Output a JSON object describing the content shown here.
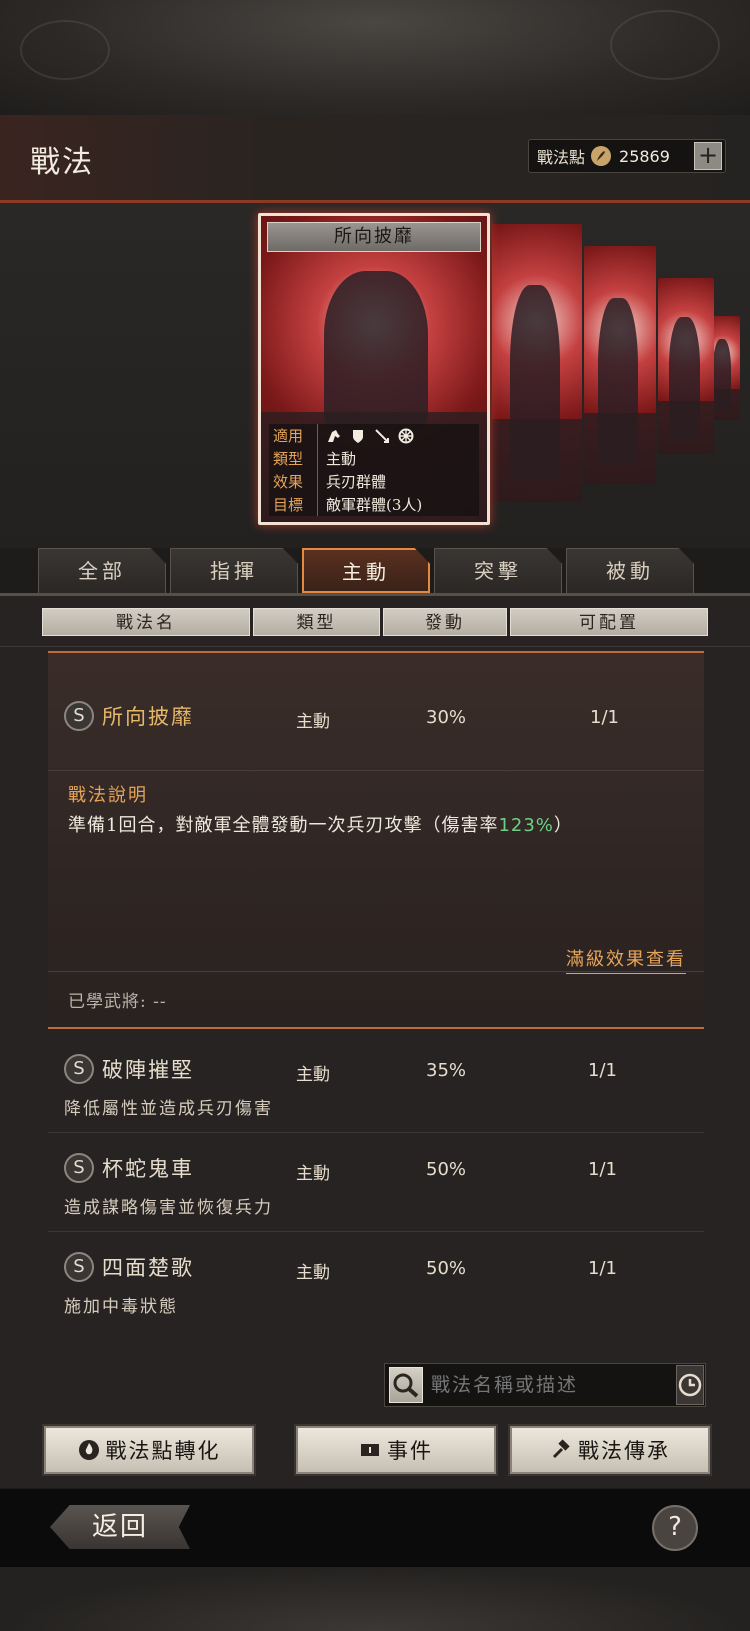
{
  "header": {
    "title": "戰法",
    "points_label": "戰法點",
    "points_value": "25869",
    "plus_label": "+"
  },
  "featured_card": {
    "title": "所向披靡",
    "applicable_label": "適用",
    "applicable_icons": [
      "cavalry-icon",
      "shield-icon",
      "bow-icon",
      "siege-wheel-icon"
    ],
    "type_label": "類型",
    "type_value": "主動",
    "effect_label": "效果",
    "effect_value": "兵刃群體",
    "target_label": "目標",
    "target_value": "敵軍群體(3人)"
  },
  "tabs": [
    {
      "label": "全部",
      "active": false
    },
    {
      "label": "指揮",
      "active": false
    },
    {
      "label": "主動",
      "active": true
    },
    {
      "label": "突擊",
      "active": false
    },
    {
      "label": "被動",
      "active": false
    }
  ],
  "columns": [
    "戰法名",
    "類型",
    "發動",
    "可配置"
  ],
  "expanded_skill": {
    "badge": "S",
    "name": "所向披靡",
    "type": "主動",
    "rate": "30%",
    "slots": "1/1",
    "desc_title": "戰法說明",
    "desc_text": "準備1回合，對敵軍全體發動一次兵刃攻擊（傷害率",
    "desc_highlight": "123%",
    "desc_end": "）",
    "full_effect_link": "滿級效果查看",
    "learned_label": "已學武將: --"
  },
  "skills": [
    {
      "badge": "S",
      "name": "破陣摧堅",
      "type": "主動",
      "rate": "35%",
      "slots": "1/1",
      "desc": "降低屬性並造成兵刃傷害"
    },
    {
      "badge": "S",
      "name": "杯蛇鬼車",
      "type": "主動",
      "rate": "50%",
      "slots": "1/1",
      "desc": "造成謀略傷害並恢復兵力"
    },
    {
      "badge": "S",
      "name": "四面楚歌",
      "type": "主動",
      "rate": "50%",
      "slots": "1/1",
      "desc": "施加中毒狀態"
    }
  ],
  "search": {
    "placeholder": "戰法名稱或描述"
  },
  "buttons": {
    "convert": "戰法點轉化",
    "events": "事件",
    "inherit": "戰法傳承"
  },
  "footer": {
    "back": "返回",
    "help": "?"
  },
  "colors": {
    "accent_orange": "#e38a40",
    "highlight_green": "#6fcf86",
    "gold_text": "#e6a458"
  }
}
